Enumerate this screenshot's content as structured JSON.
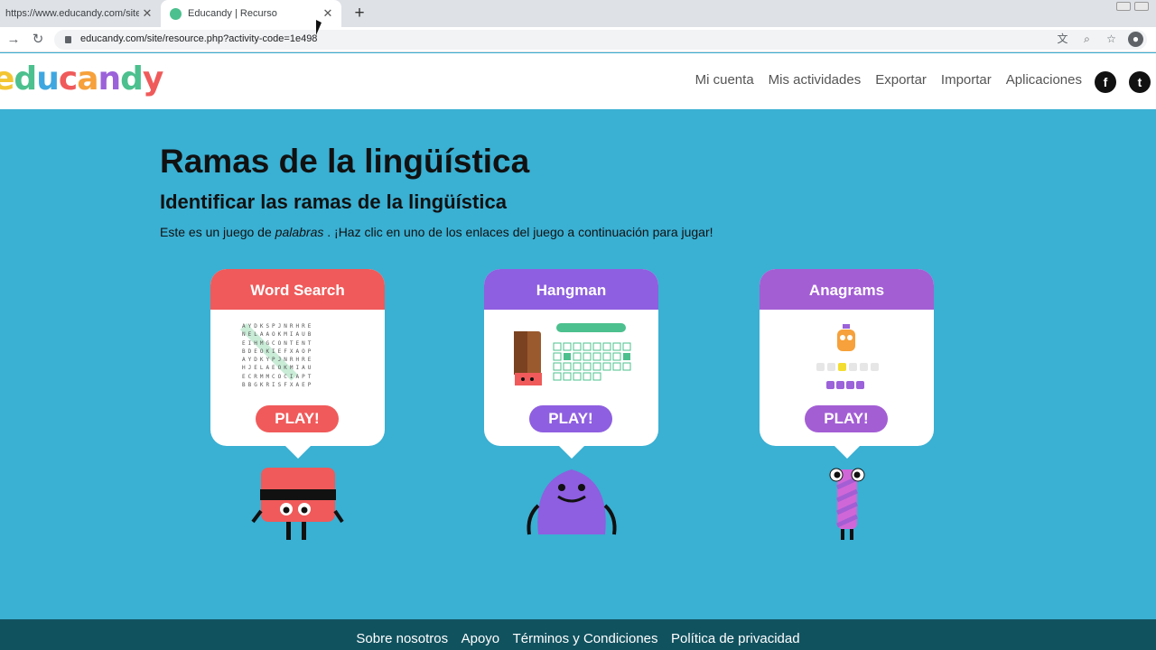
{
  "browser": {
    "tabs": [
      {
        "title": "https://www.educandy.com/site",
        "active": false
      },
      {
        "title": "Educandy | Recurso",
        "active": true
      }
    ],
    "url": "educandy.com/site/resource.php?activity-code=1e498"
  },
  "header": {
    "logo": [
      "e",
      "d",
      "u",
      "c",
      "a",
      "n",
      "d",
      "y"
    ],
    "nav": [
      "Mi cuenta",
      "Mis actividades",
      "Exportar",
      "Importar",
      "Aplicaciones"
    ],
    "social": [
      {
        "icon": "facebook-icon",
        "glyph": "f"
      },
      {
        "icon": "twitter-icon",
        "glyph": "t"
      }
    ]
  },
  "main": {
    "title": "Ramas de la lingüística",
    "subtitle": "Identificar las ramas de la lingüística",
    "intro_before": "Este es un juego de ",
    "intro_em": "palabras",
    "intro_after": " . ¡Haz clic en uno de los enlaces del juego a continuación para jugar!"
  },
  "games": [
    {
      "name": "Word Search",
      "play": "PLAY!",
      "color": "#f05a5a"
    },
    {
      "name": "Hangman",
      "play": "PLAY!",
      "color": "#8e5fe0"
    },
    {
      "name": "Anagrams",
      "play": "PLAY!",
      "color": "#a35ed4"
    }
  ],
  "footer": {
    "links": [
      "Sobre nosotros",
      "Apoyo",
      "Términos y Condiciones",
      "Política de privacidad"
    ]
  }
}
